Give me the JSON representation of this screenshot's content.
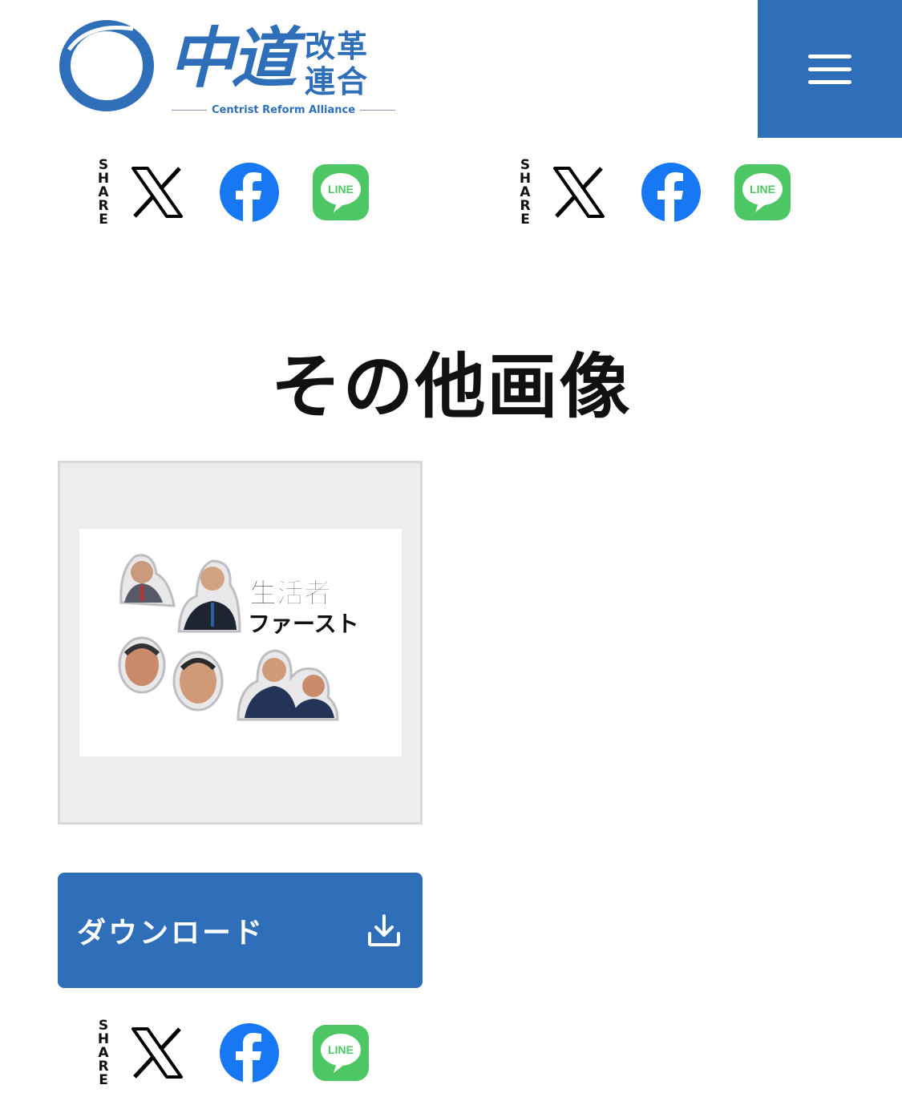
{
  "brand": {
    "name_main": "中道",
    "name_sub": "改革連合",
    "name_en": "Centrist Reform Alliance",
    "color": "#2f6fb9"
  },
  "header": {
    "menu_icon": "hamburger-menu-icon"
  },
  "share": {
    "label_letters": [
      "S",
      "H",
      "A",
      "R",
      "E"
    ],
    "networks": [
      {
        "name": "X",
        "icon": "x-icon"
      },
      {
        "name": "Facebook",
        "icon": "facebook-icon",
        "color": "#1877f2"
      },
      {
        "name": "LINE",
        "icon": "line-icon",
        "color": "#4cc764",
        "text": "LINE"
      }
    ]
  },
  "section": {
    "title": "その他画像"
  },
  "image_card": {
    "slogan_line1": "生活者",
    "slogan_line2": "ファースト"
  },
  "download": {
    "label": "ダウンロード",
    "icon": "download-icon"
  }
}
